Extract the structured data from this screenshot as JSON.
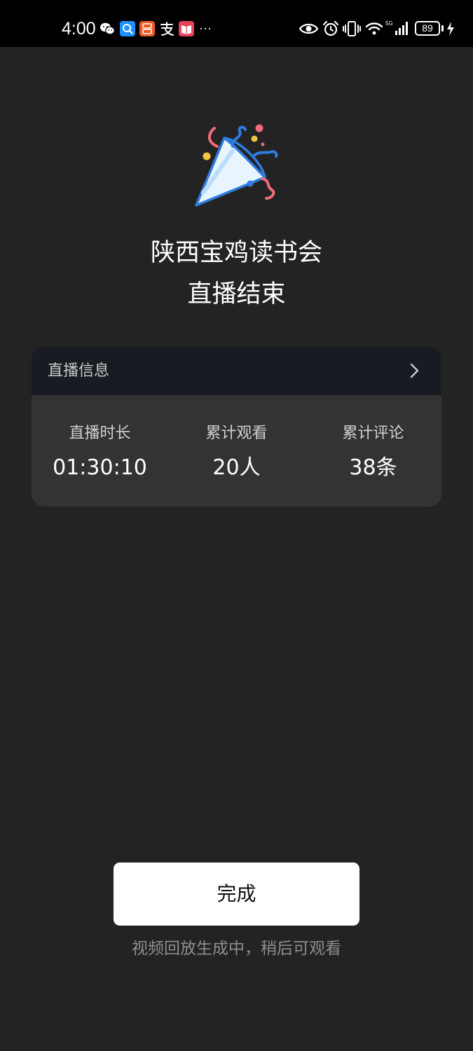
{
  "status_bar": {
    "time": "4:00",
    "more": "···",
    "battery_level": "89",
    "icons": [
      "wechat-icon",
      "search-app-icon",
      "orange-app-icon",
      "alipay-icon",
      "reader-app-icon",
      "eye-icon",
      "alarm-icon",
      "vibrate-icon",
      "wifi-icon",
      "signal-5g-icon",
      "charging-icon"
    ]
  },
  "hero": {
    "icon": "party-popper-icon",
    "title_line1": "陕西宝鸡读书会",
    "title_line2": "直播结束"
  },
  "info_card": {
    "header_label": "直播信息",
    "stats": [
      {
        "label": "直播时长",
        "value": "01:30:10"
      },
      {
        "label": "累计观看",
        "value": "20人"
      },
      {
        "label": "累计评论",
        "value": "38条"
      }
    ]
  },
  "footer": {
    "done_label": "完成",
    "note": "视频回放生成中，稍后可观看"
  },
  "colors": {
    "background": "#232323",
    "card": "#333333",
    "card_header": "#181b22",
    "button": "#ffffff",
    "note_text": "#8e8e8e"
  }
}
